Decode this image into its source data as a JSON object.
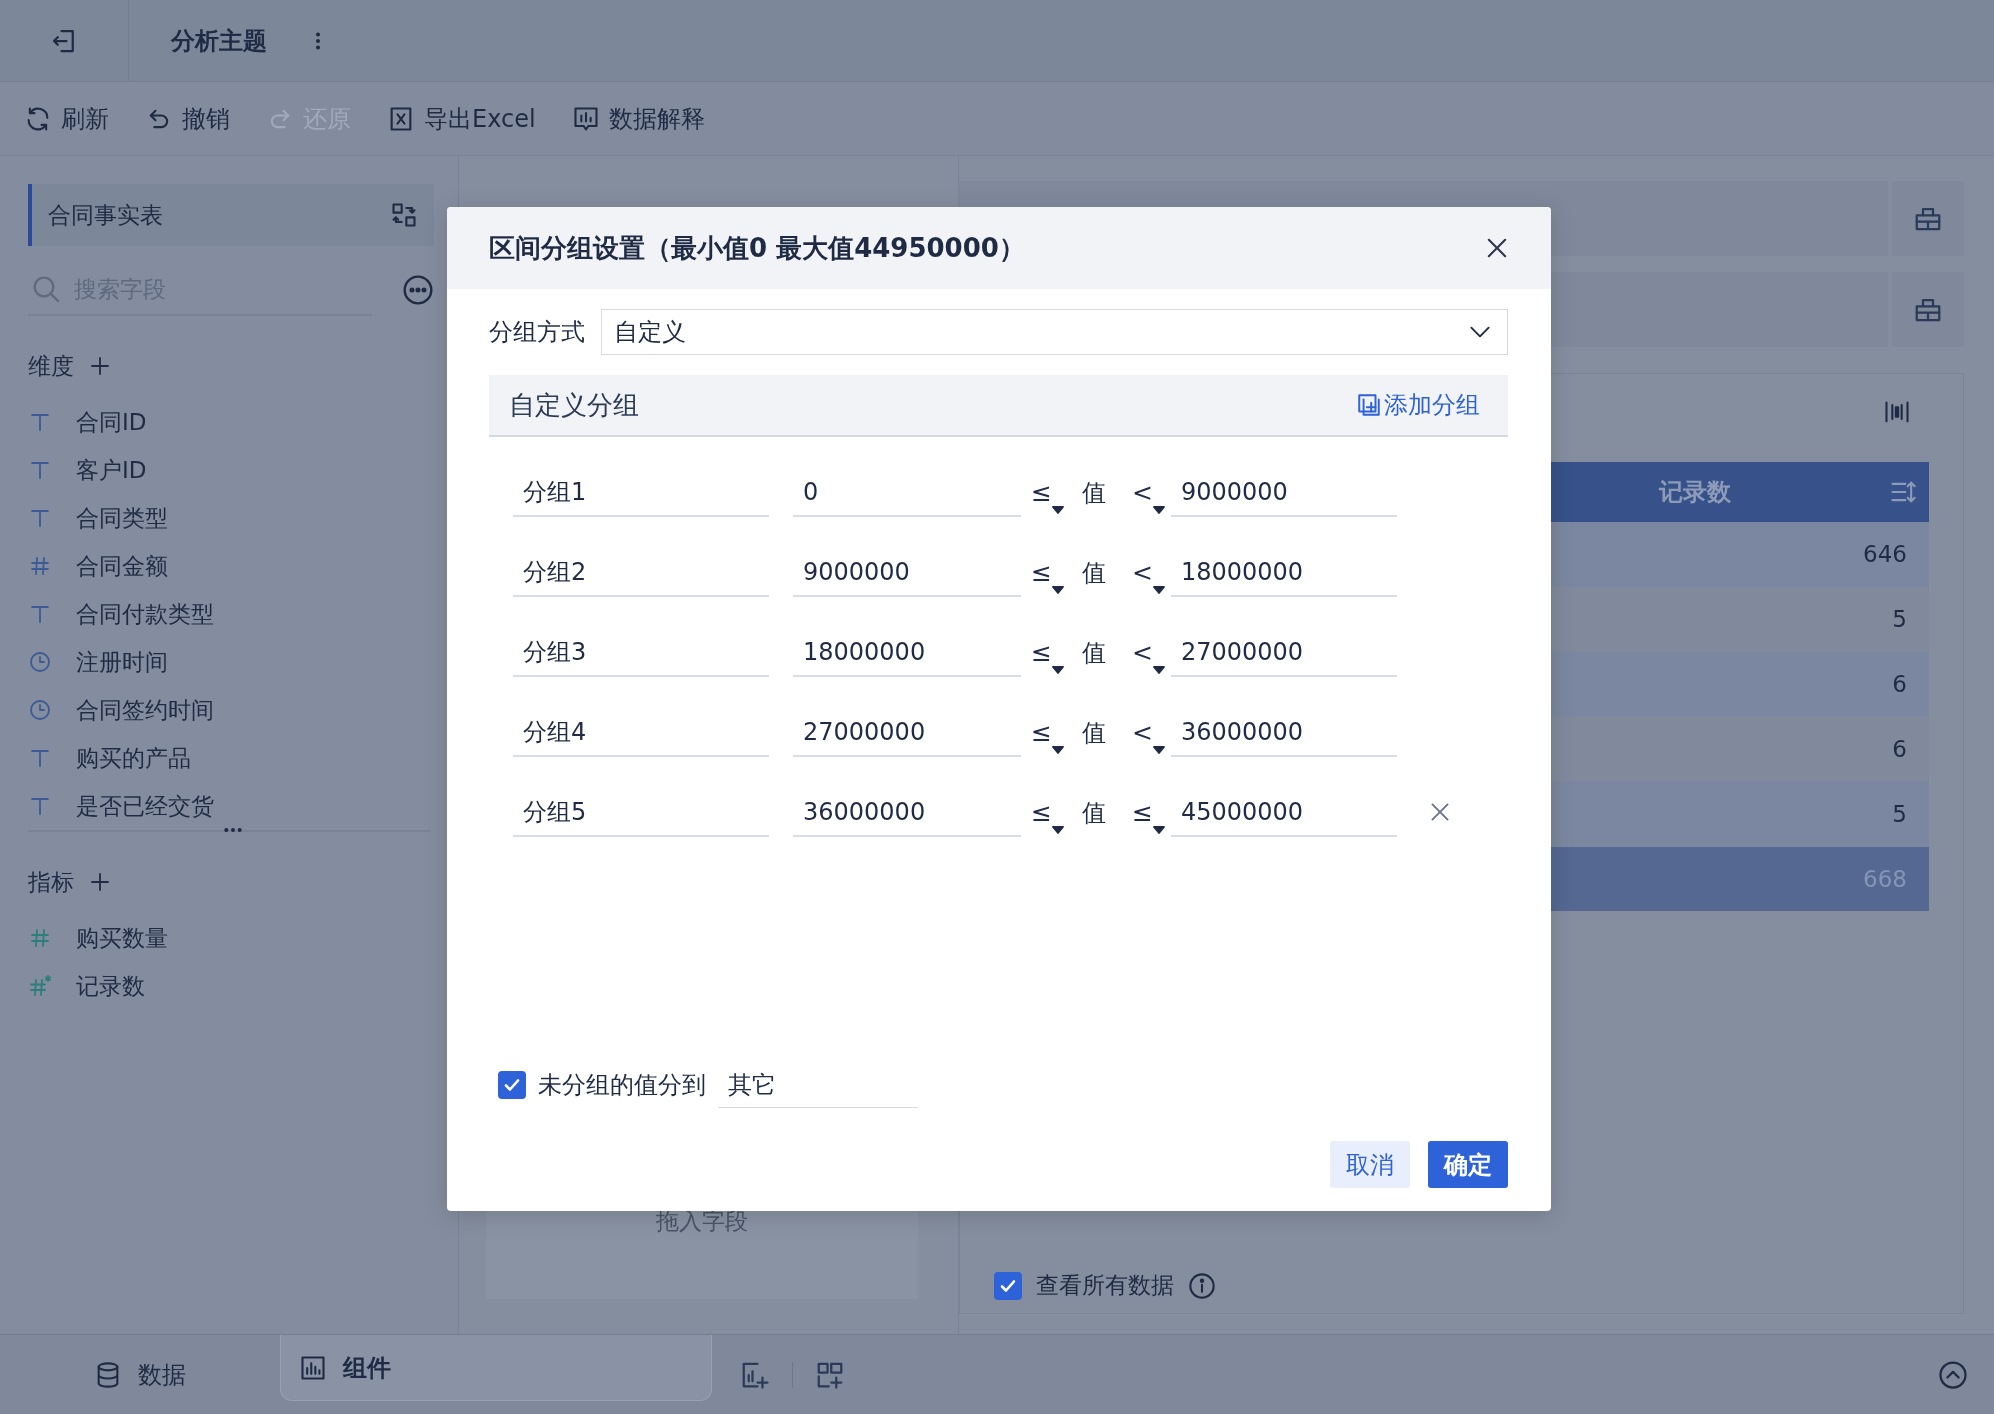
{
  "header": {
    "title": "分析主题"
  },
  "toolbar": [
    {
      "label": "刷新",
      "kind": "refresh",
      "disabled": false
    },
    {
      "label": "撤销",
      "kind": "undo",
      "disabled": false
    },
    {
      "label": "还原",
      "kind": "redo",
      "disabled": true
    },
    {
      "label": "导出Excel",
      "kind": "export",
      "disabled": false
    },
    {
      "label": "数据解释",
      "kind": "explain",
      "disabled": false
    }
  ],
  "sidebar": {
    "table_name": "合同事实表",
    "search": {
      "placeholder": "搜索字段"
    },
    "dimensions": {
      "title": "维度",
      "fields": [
        {
          "name": "合同ID",
          "kind": "text"
        },
        {
          "name": "客户ID",
          "kind": "text"
        },
        {
          "name": "合同类型",
          "kind": "text"
        },
        {
          "name": "合同金额",
          "kind": "number"
        },
        {
          "name": "合同付款类型",
          "kind": "text"
        },
        {
          "name": "注册时间",
          "kind": "date"
        },
        {
          "name": "合同签约时间",
          "kind": "date"
        },
        {
          "name": "购买的产品",
          "kind": "text"
        },
        {
          "name": "是否已经交货",
          "kind": "text"
        }
      ]
    },
    "measures": {
      "title": "指标",
      "fields": [
        {
          "name": "购买数量",
          "kind": "number"
        },
        {
          "name": "记录数",
          "kind": "count"
        }
      ]
    }
  },
  "workspace": {
    "drop_hint": "拖入字段",
    "table": {
      "column": "记录数",
      "rows": [
        "646",
        "5",
        "6",
        "6",
        "5"
      ],
      "total": "668"
    },
    "show_all": {
      "label": "查看所有数据",
      "checked": true
    }
  },
  "bottom_tabs": [
    {
      "label": "数据",
      "kind": "data",
      "selected": false
    },
    {
      "label": "组件",
      "kind": "component",
      "selected": true
    }
  ],
  "dialog": {
    "title": "区间分组设置（最小值0 最大值44950000）",
    "method": {
      "label": "分组方式",
      "value": "自定义"
    },
    "custom": {
      "title": "自定义分组",
      "add_label": "添加分组",
      "groups": [
        {
          "name": "分组1",
          "from": "0",
          "lower_op": "≤",
          "value_label": "值",
          "upper_op": "<",
          "to": "9000000",
          "removable": false
        },
        {
          "name": "分组2",
          "from": "9000000",
          "lower_op": "≤",
          "value_label": "值",
          "upper_op": "<",
          "to": "18000000",
          "removable": false
        },
        {
          "name": "分组3",
          "from": "18000000",
          "lower_op": "≤",
          "value_label": "值",
          "upper_op": "<",
          "to": "27000000",
          "removable": false
        },
        {
          "name": "分组4",
          "from": "27000000",
          "lower_op": "≤",
          "value_label": "值",
          "upper_op": "<",
          "to": "36000000",
          "removable": false
        },
        {
          "name": "分组5",
          "from": "36000000",
          "lower_op": "≤",
          "value_label": "值",
          "upper_op": "≤",
          "to": "45000000",
          "removable": true
        }
      ]
    },
    "other": {
      "checked": true,
      "label": "未分组的值分到",
      "value": "其它"
    },
    "buttons": [
      {
        "label": "取消",
        "kind": "secondary"
      },
      {
        "label": "确定",
        "kind": "primary"
      }
    ]
  }
}
